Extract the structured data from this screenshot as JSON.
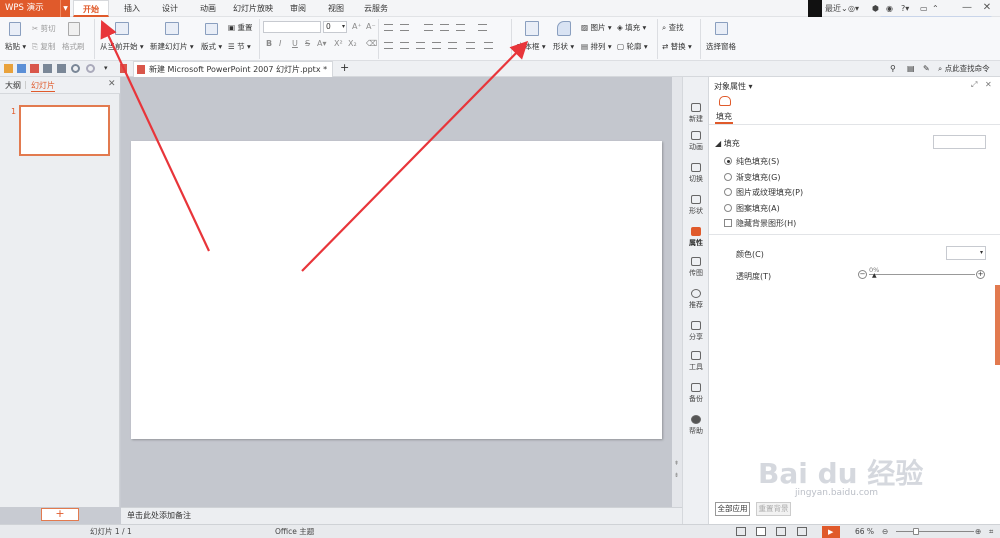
{
  "titlebar": {
    "app_button": "WPS 演示",
    "tabs": [
      "开始",
      "插入",
      "设计",
      "动画",
      "幻灯片放映",
      "审阅",
      "视图",
      "云服务"
    ],
    "recent": "最近",
    "ime": [
      "中",
      "°,",
      "☽",
      "☻"
    ]
  },
  "ribbon": {
    "paste": "粘贴",
    "cut": "剪切",
    "copy": "复制",
    "format_painter": "格式刷",
    "from_current": "从当前开始",
    "new_slide": "新建幻灯片",
    "layout": "版式",
    "reset": "重置",
    "section": "节",
    "font_size": "0",
    "text_box": "文本框",
    "shape": "形状",
    "picture": "图片",
    "fill": "填充",
    "arrange": "排列",
    "outline": "轮廓",
    "find": "查找",
    "replace": "替换",
    "select_pane": "选择窗格"
  },
  "quickbar": {
    "doc_tab": "新建 Microsoft PowerPoint 2007 幻灯片.pptx *",
    "find_cmd": "点此查找命令"
  },
  "leftpanel": {
    "tab_outline": "大纲",
    "tab_slides": "幻灯片",
    "slide_number": "1",
    "add_button": "+"
  },
  "notes": {
    "placeholder": "单击此处添加备注"
  },
  "sidenav": [
    "新建",
    "动画",
    "切换",
    "形状",
    "属性",
    "传图",
    "推荐",
    "分享",
    "工具",
    "备份",
    "帮助"
  ],
  "properties": {
    "title": "对象属性",
    "tab_fill": "填充",
    "section_fill": "填充",
    "options": [
      "纯色填充(S)",
      "渐变填充(G)",
      "图片或纹理填充(P)",
      "图案填充(A)"
    ],
    "hide_bg": "隐藏背景图形(H)",
    "color_label": "颜色(C)",
    "transparency_label": "透明度(T)",
    "transparency_value": "0%",
    "apply_all": "全部应用",
    "reset_bg": "重置背景"
  },
  "statusbar": {
    "slide_info": "幻灯片 1 / 1",
    "theme": "Office 主题",
    "zoom": "66 %"
  },
  "watermark": {
    "main": "Bai du 经验",
    "sub": "jingyan.baidu.com"
  },
  "colors": {
    "accent": "#e05a2b",
    "arrow": "#e8353a"
  }
}
